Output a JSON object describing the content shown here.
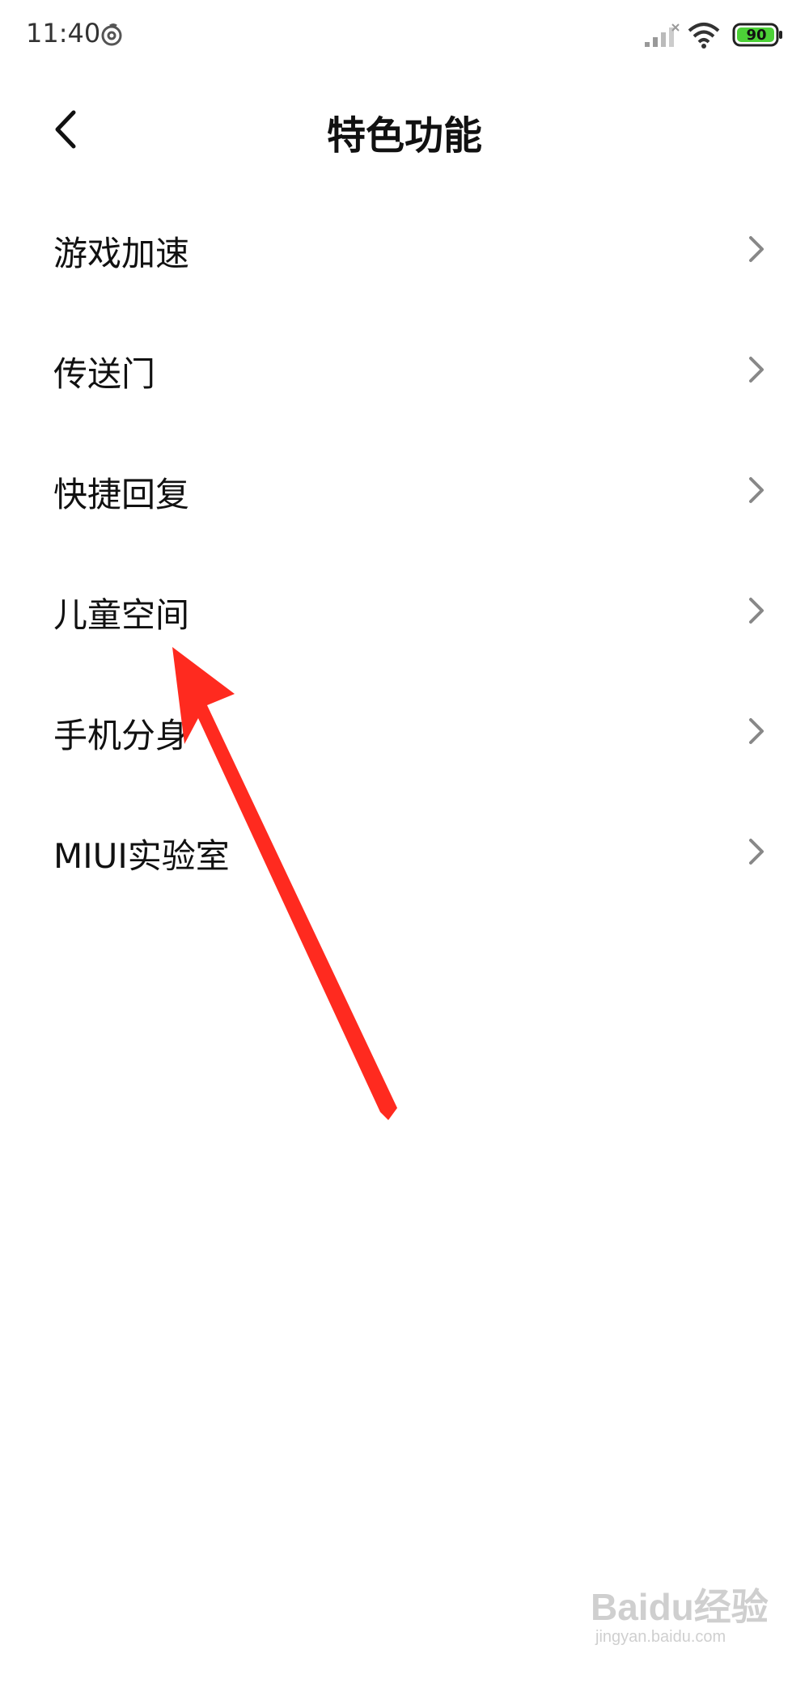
{
  "status_bar": {
    "time": "11:40",
    "battery_level": "90",
    "battery_color": "#4cd137",
    "icons": [
      "app-notification-icon",
      "signal-icon",
      "wifi-icon",
      "battery-icon"
    ]
  },
  "header": {
    "title": "特色功能",
    "back_icon": "chevron-left-icon"
  },
  "menu": {
    "items": [
      {
        "label": "游戏加速"
      },
      {
        "label": "传送门"
      },
      {
        "label": "快捷回复"
      },
      {
        "label": "儿童空间"
      },
      {
        "label": "手机分身"
      },
      {
        "label": "MIUI实验室"
      }
    ],
    "chevron_icon": "chevron-right-icon"
  },
  "annotation": {
    "arrow_color": "#ff2a1f",
    "points_to": "儿童空间"
  },
  "watermark": {
    "text": "Baidu经验",
    "sub": "jingyan.baidu.com"
  }
}
